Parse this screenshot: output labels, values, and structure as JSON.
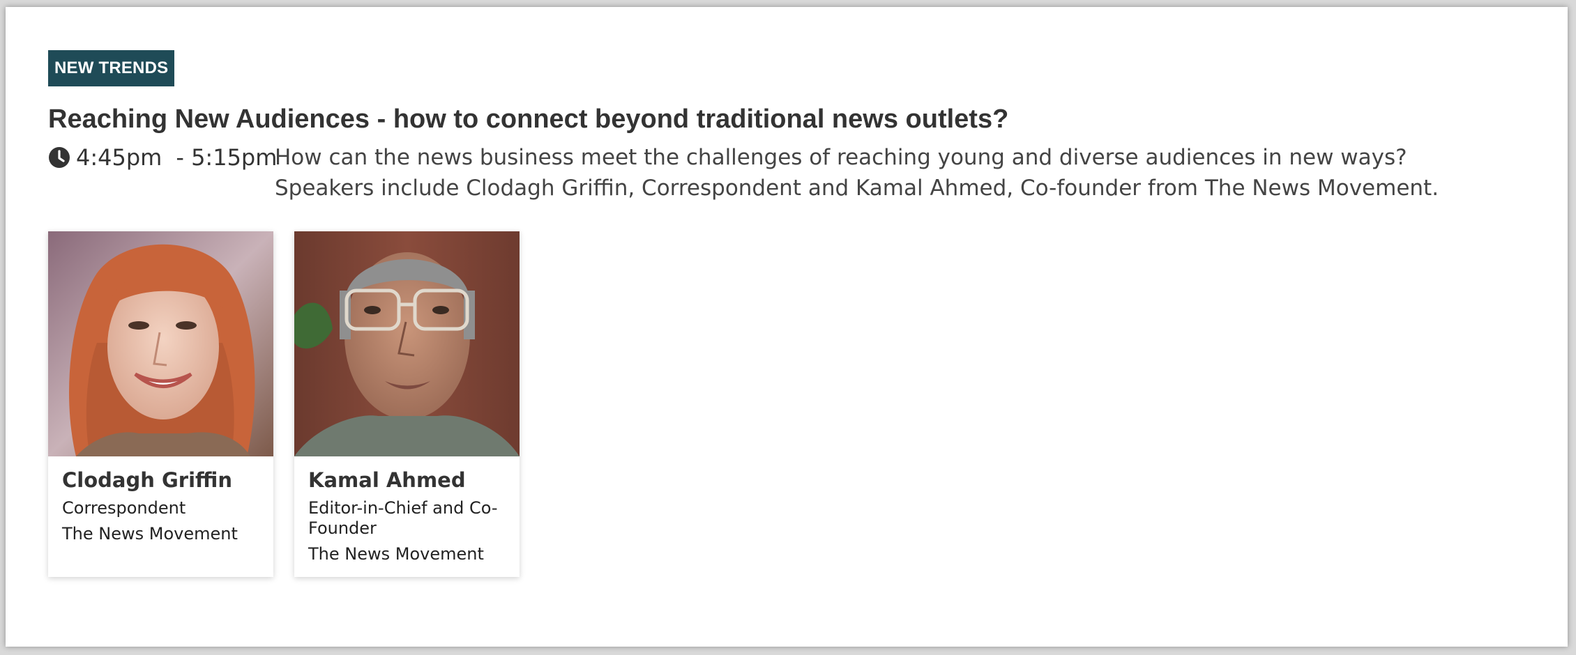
{
  "session": {
    "badge": "NEW TRENDS",
    "title": "Reaching New Audiences - how to connect beyond traditional news outlets?",
    "time_start": "4:45pm",
    "time_end": "- 5:15pm",
    "description_line1": "How can the news business meet the challenges of reaching young and diverse audiences in new ways?",
    "description_line2": "Speakers include Clodagh Griffin, Correspondent and Kamal Ahmed, Co-founder from The News Movement."
  },
  "speakers": [
    {
      "name": "Clodagh Griffin",
      "role": "Correspondent",
      "organization": "The News Movement"
    },
    {
      "name": "Kamal Ahmed",
      "role": "Editor-in-Chief and Co-Founder",
      "organization": "The News Movement"
    }
  ],
  "colors": {
    "badge_bg": "#1f4b57",
    "title_text": "#333333"
  },
  "icons": {
    "time": "clock-icon"
  }
}
